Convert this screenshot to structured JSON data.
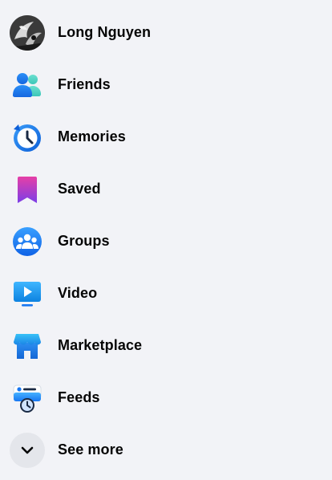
{
  "profile": {
    "name": "Long Nguyen"
  },
  "menu": [
    {
      "label": "Friends",
      "icon": "friends-icon"
    },
    {
      "label": "Memories",
      "icon": "memories-icon"
    },
    {
      "label": "Saved",
      "icon": "saved-icon"
    },
    {
      "label": "Groups",
      "icon": "groups-icon"
    },
    {
      "label": "Video",
      "icon": "video-icon"
    },
    {
      "label": "Marketplace",
      "icon": "marketplace-icon"
    },
    {
      "label": "Feeds",
      "icon": "feeds-icon"
    }
  ],
  "see_more": {
    "label": "See more",
    "icon": "chevron-down-icon"
  },
  "colors": {
    "background": "#f2f3f7",
    "text": "#050505",
    "accent_blue": "#1877f2",
    "more_bg": "#e4e6eb"
  }
}
